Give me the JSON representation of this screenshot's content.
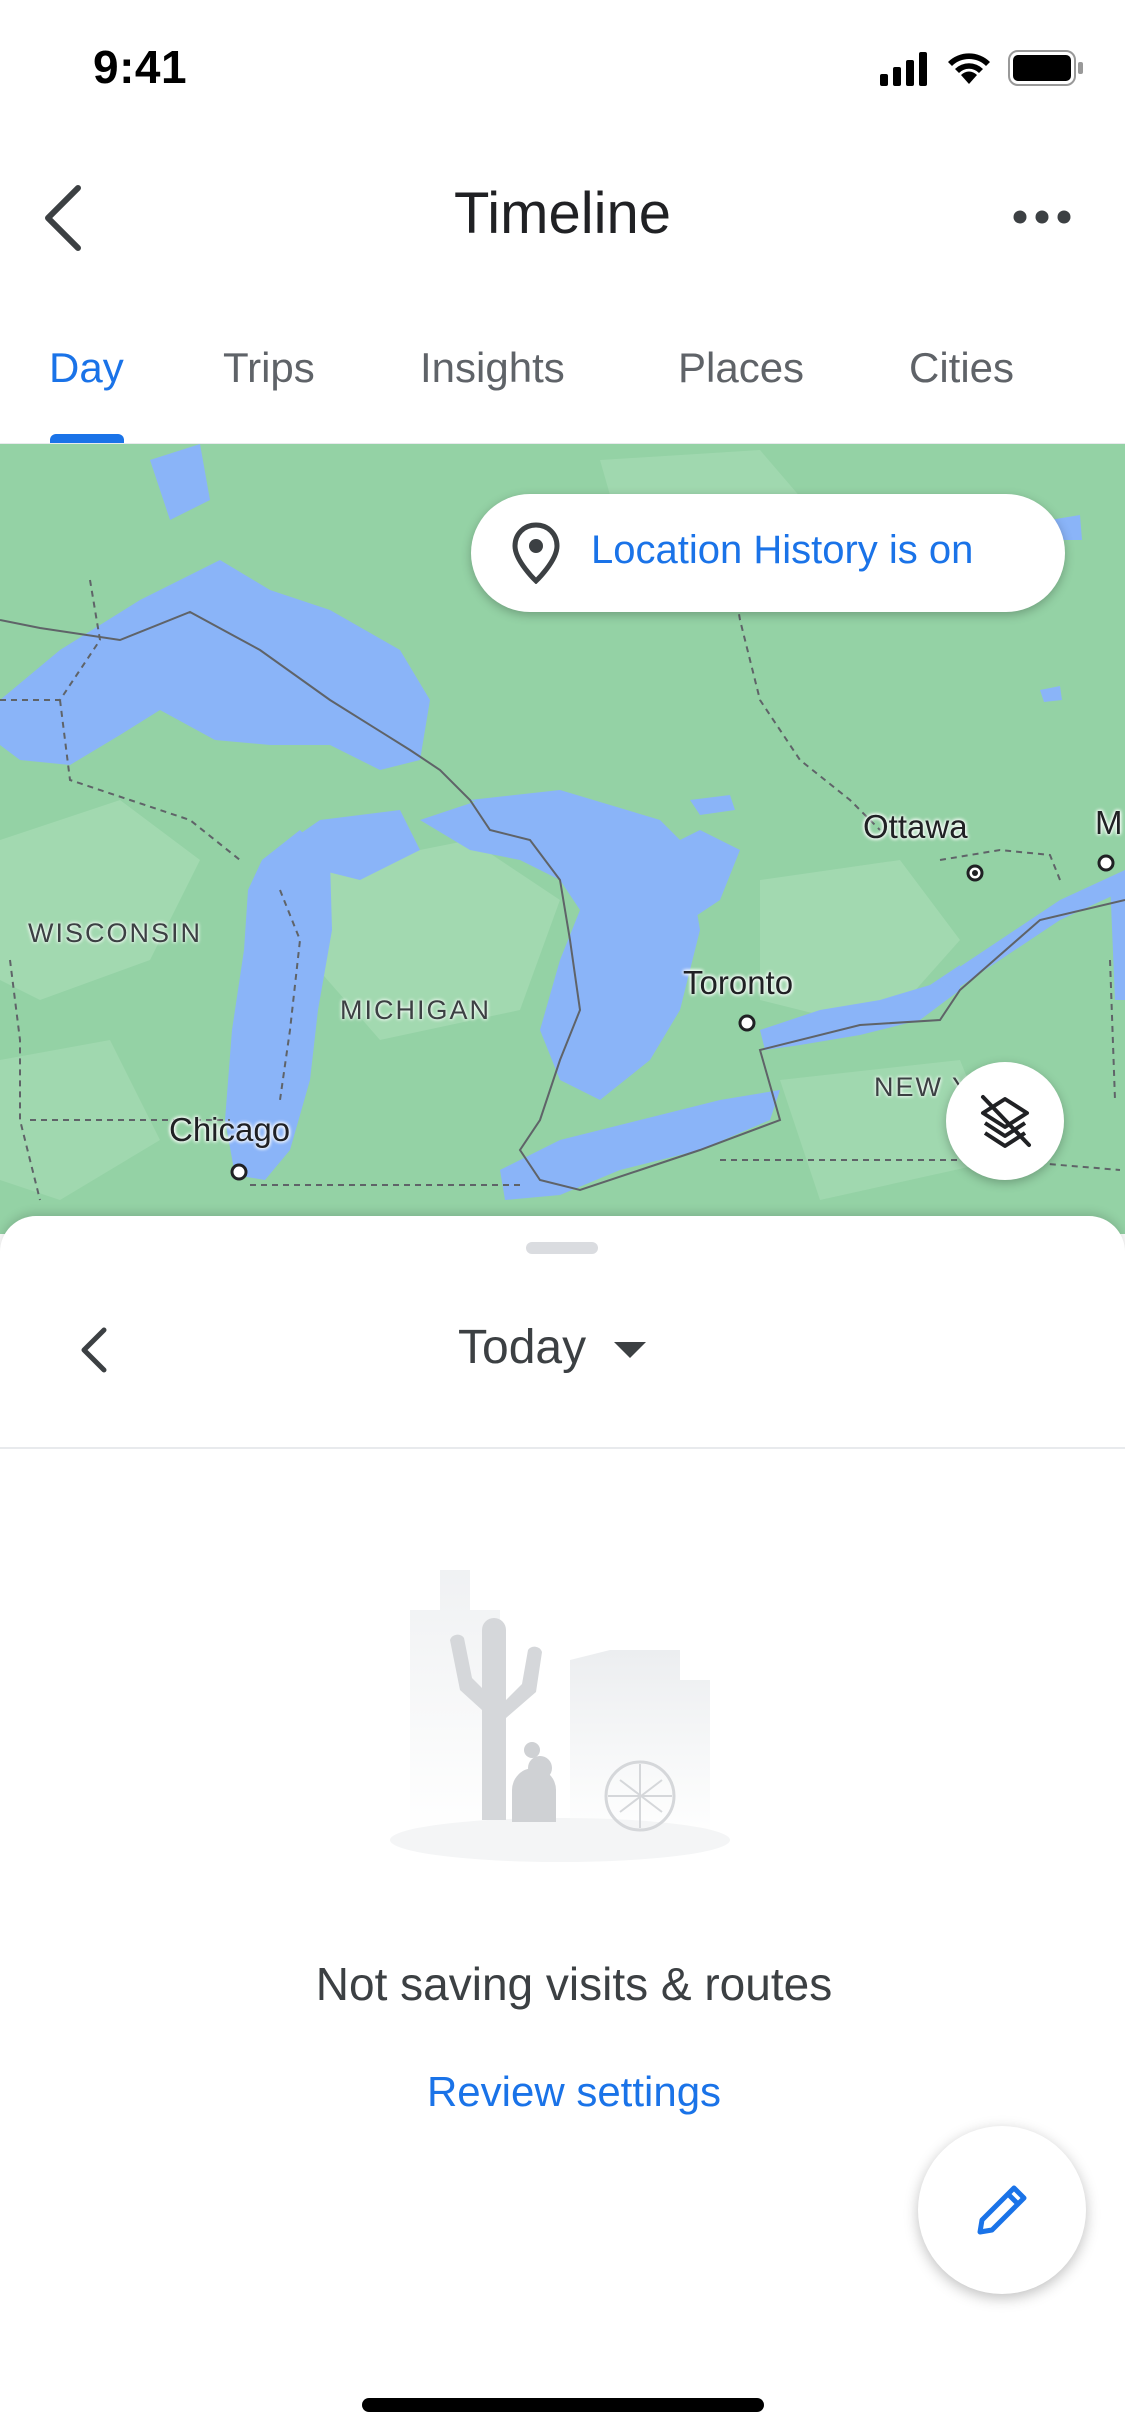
{
  "status_bar": {
    "time": "9:41"
  },
  "app_bar": {
    "title": "Timeline",
    "back_icon": "chevron-left-icon",
    "more_icon": "more-horizontal-icon"
  },
  "tabs": [
    {
      "label": "Day",
      "active": true
    },
    {
      "label": "Trips",
      "active": false
    },
    {
      "label": "Insights",
      "active": false
    },
    {
      "label": "Places",
      "active": false
    },
    {
      "label": "Cities",
      "active": false
    }
  ],
  "map": {
    "location_pill": {
      "text": "Location History is on",
      "icon": "location-pin-icon"
    },
    "cities": [
      "Ottawa",
      "Toronto",
      "Chicago",
      "M"
    ],
    "regions": [
      "WISCONSIN",
      "MICHIGAN",
      "NEW Y"
    ],
    "layers_icon": "layers-off-icon",
    "colors": {
      "land": "#94d2a5",
      "water": "#8ab4f8"
    }
  },
  "sheet": {
    "date_label": "Today",
    "empty_title": "Not saving visits & routes",
    "review_link": "Review settings",
    "fab_icon": "edit-pencil-icon"
  },
  "colors": {
    "accent": "#1a73e8",
    "text": "#202124",
    "secondary": "#5f6368"
  }
}
